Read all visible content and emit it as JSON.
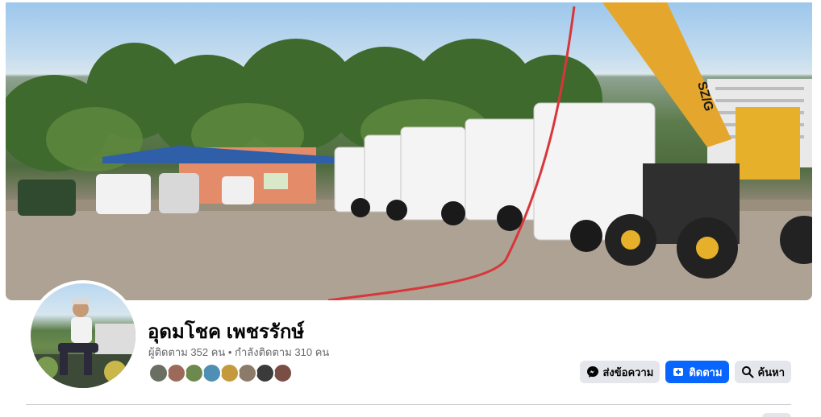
{
  "profile": {
    "name": "อุดมโชค เพชรรักษ์",
    "followers_text": "ผู้ติดตาม 352 คน",
    "separator": " • ",
    "following_text": "กำลังติดตาม 310 คน"
  },
  "cover": {
    "machine_brand": "SZ/G",
    "icon": "cover-photo"
  },
  "friends": [
    {
      "color": "#6b6f63"
    },
    {
      "color": "#9b6a5a"
    },
    {
      "color": "#6d8a4e"
    },
    {
      "color": "#4f8fb5"
    },
    {
      "color": "#c49a3d"
    },
    {
      "color": "#8d7b6a"
    },
    {
      "color": "#3a3a3a"
    },
    {
      "color": "#7a4e44"
    }
  ],
  "actions": {
    "message_label": "ส่งข้อความ",
    "follow_label": "ติดตาม",
    "search_label": "ค้นหา"
  },
  "colors": {
    "primary": "#0866ff",
    "button_gray": "#e4e6eb",
    "text": "#050505",
    "secondary_text": "#65676b"
  }
}
